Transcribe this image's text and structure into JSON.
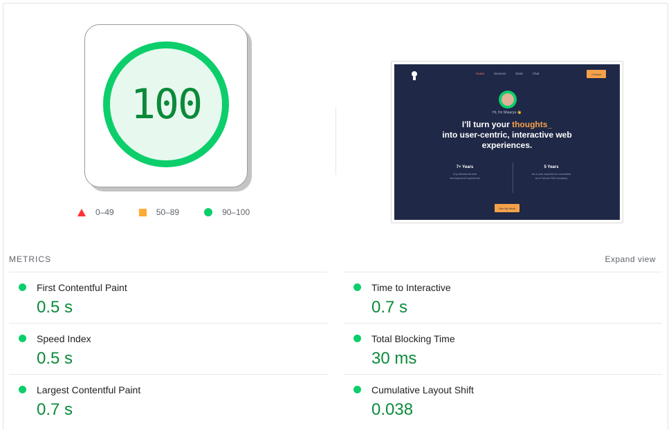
{
  "score": {
    "value": "100",
    "level": 1.0,
    "ring_color": "#0cce6b",
    "fill_color": "#e7f9ef",
    "text_color": "#0c8a3a"
  },
  "legend": [
    {
      "shape": "triangle",
      "label": "0–49",
      "color": "#ff3333"
    },
    {
      "shape": "square",
      "label": "50–89",
      "color": "#ffaa33"
    },
    {
      "shape": "circle",
      "label": "90–100",
      "color": "#0cce6b"
    }
  ],
  "preview": {
    "nav": [
      "Home",
      "Services",
      "Work",
      "Chat"
    ],
    "contact_label": "Contact",
    "name": "Hi, I'm Shaurya 👋",
    "headline_pre": "I'll turn your ",
    "headline_highlight": "thoughts_",
    "headline_line2": "into user-centric, interactive web",
    "headline_line3": "experiences.",
    "stats": [
      {
        "big": "7+ Years",
        "small1": "of professional web",
        "small2": "development experience"
      },
      {
        "big": "5 Years",
        "small1": "as a user experience consultant",
        "small2": "at a Fortune 500 company"
      }
    ],
    "cta_label": "See My Work"
  },
  "metrics": {
    "title": "METRICS",
    "expand_label": "Expand view",
    "left": [
      {
        "name": "First Contentful Paint",
        "value": "0.5 s"
      },
      {
        "name": "Speed Index",
        "value": "0.5 s"
      },
      {
        "name": "Largest Contentful Paint",
        "value": "0.7 s"
      }
    ],
    "right": [
      {
        "name": "Time to Interactive",
        "value": "0.7 s"
      },
      {
        "name": "Total Blocking Time",
        "value": "30 ms"
      },
      {
        "name": "Cumulative Layout Shift",
        "value": "0.038"
      }
    ]
  }
}
